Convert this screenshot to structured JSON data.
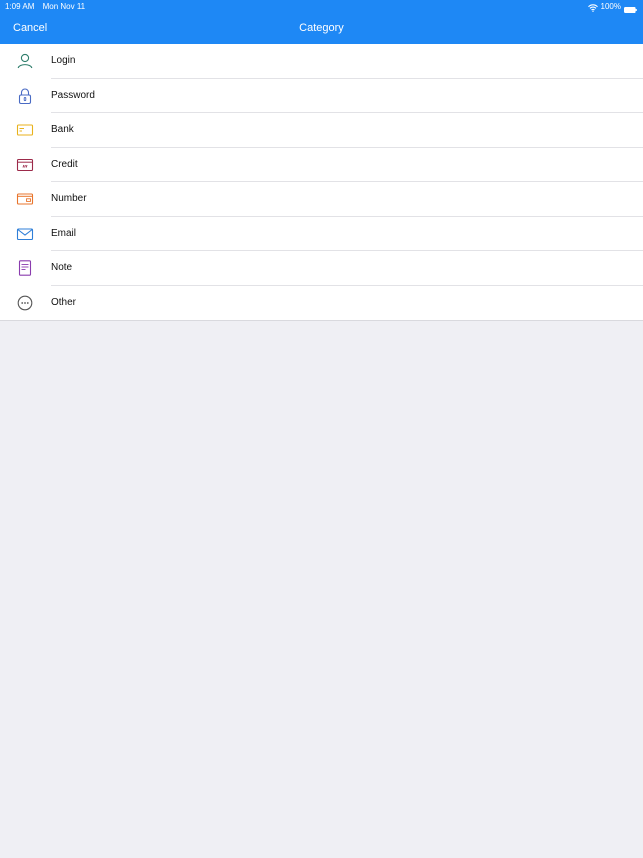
{
  "status_bar": {
    "time": "1:09 AM",
    "date": "Mon Nov 11",
    "battery": "100%"
  },
  "nav": {
    "cancel_label": "Cancel",
    "title": "Category"
  },
  "categories": [
    {
      "label": "Login",
      "icon": "person-icon",
      "color": "#2e7d6b"
    },
    {
      "label": "Password",
      "icon": "lock-icon",
      "color": "#4a6bc4"
    },
    {
      "label": "Bank",
      "icon": "bank-card-icon",
      "color": "#e8b21c"
    },
    {
      "label": "Credit",
      "icon": "credit-card-icon",
      "color": "#9c2a4a"
    },
    {
      "label": "Number",
      "icon": "wallet-icon",
      "color": "#e8742c"
    },
    {
      "label": "Email",
      "icon": "envelope-icon",
      "color": "#2f7fd8"
    },
    {
      "label": "Note",
      "icon": "note-icon",
      "color": "#8a3cae"
    },
    {
      "label": "Other",
      "icon": "ellipsis-circle-icon",
      "color": "#555555"
    }
  ],
  "colors": {
    "header": "#1e88f5",
    "background": "#efeff4"
  }
}
